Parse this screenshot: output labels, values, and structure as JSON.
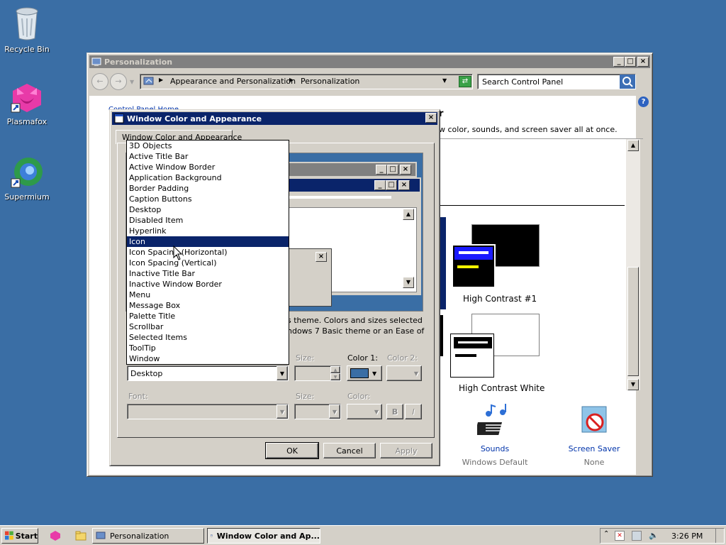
{
  "desktop": {
    "icons": [
      {
        "label": "Recycle Bin",
        "icon": "recycle-bin-icon"
      },
      {
        "label": "Plasmafox",
        "icon": "plasmafox-icon"
      },
      {
        "label": "Supermium",
        "icon": "supermium-icon"
      }
    ]
  },
  "personalization": {
    "title": "Personalization",
    "breadcrumb": [
      "Appearance and Personalization",
      "Personalization"
    ],
    "search_placeholder": "Search Control Panel",
    "control_panel_home": "Control Panel Home",
    "heading_fragment": "r",
    "intro_fragment": "w color, sounds, and screen saver all at once.",
    "themes": [
      {
        "name": "High Contrast #1"
      },
      {
        "name": "High Contrast White"
      }
    ],
    "bottom_items": [
      {
        "title": "Sounds",
        "subtitle": "Windows Default",
        "icon": "sounds-icon"
      },
      {
        "title": "Screen Saver",
        "subtitle": "None",
        "icon": "screen-saver-icon"
      }
    ]
  },
  "dialog": {
    "title": "Window Color and Appearance",
    "tab": "Window Color and Appearance",
    "info_line1": "s theme.  Colors and sizes selected",
    "info_line2": "ndows 7 Basic theme or an Ease of",
    "item_options": [
      "3D Objects",
      "Active Title Bar",
      "Active Window Border",
      "Application Background",
      "Border Padding",
      "Caption Buttons",
      "Desktop",
      "Disabled Item",
      "Hyperlink",
      "Icon",
      "Icon Spacing (Horizontal)",
      "Icon Spacing (Vertical)",
      "Inactive Title Bar",
      "Inactive Window Border",
      "Menu",
      "Message Box",
      "Palette Title",
      "Scrollbar",
      "Selected Items",
      "ToolTip",
      "Window"
    ],
    "highlighted_option": "Icon",
    "item_value": "Desktop",
    "size_label": "Size:",
    "color1_label": "Color 1:",
    "color2_label": "Color 2:",
    "color1_value": "#3a6ea5",
    "font_label": "Font:",
    "font_size_label": "Size:",
    "font_color_label": "Color:",
    "bold_label": "B",
    "italic_label": "I",
    "ok": "OK",
    "cancel": "Cancel",
    "apply": "Apply"
  },
  "taskbar": {
    "start": "Start",
    "tasks": [
      "Personalization",
      "Window Color and Ap..."
    ],
    "clock": "3:26 PM"
  }
}
